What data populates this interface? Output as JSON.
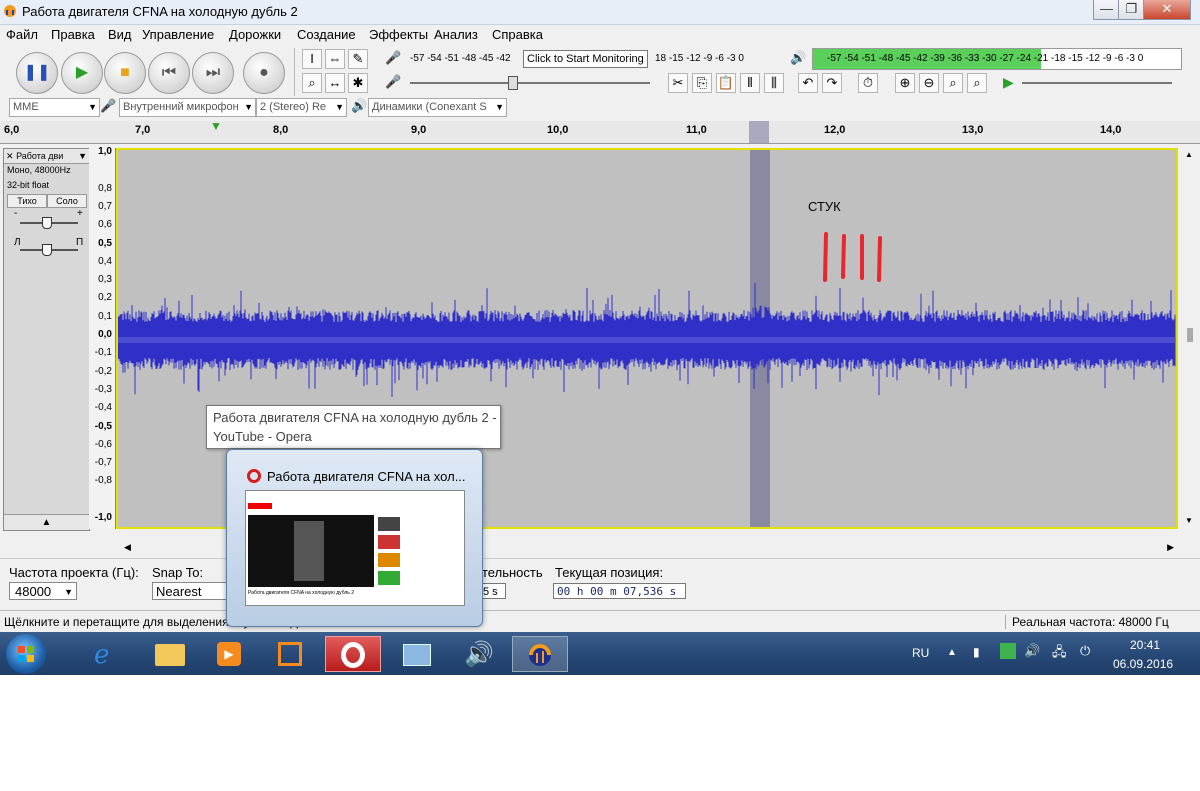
{
  "window": {
    "title": "Работа двигателя CFNA на холодную дубль 2",
    "buttons": {
      "minimize": "—",
      "maximize": "❐",
      "close": "✕"
    }
  },
  "menu": [
    "Файл",
    "Правка",
    "Вид",
    "Управление",
    "Дорожки",
    "Создание",
    "Эффекты",
    "Анализ",
    "Справка"
  ],
  "meters": {
    "record_scale": "-57 -54 -51 -48 -45 -42",
    "record_scale_right": "18 -15 -12 -9 -6 -3 0",
    "monitor_tooltip": "Click to Start Monitoring",
    "playback_scale": "-57 -54 -51 -48 -45 -42 -39 -36 -33 -30 -27 -24 -21 -18 -15 -12 -9 -6 -3 0",
    "playback_level": 0.62
  },
  "devices": {
    "host": "MME",
    "mic": "Внутренний микрофон",
    "channels": "2 (Stereo) Re",
    "speakers": "Динамики (Conexant S"
  },
  "ruler": {
    "labels": [
      "6,0",
      "7,0",
      "8,0",
      "9,0",
      "10,0",
      "11,0",
      "12,0",
      "13,0",
      "14,0"
    ],
    "cursor_label": "▼"
  },
  "track": {
    "name": "Работа дви",
    "info1": "Моно, 48000Hz",
    "info2": "32-bit float",
    "mute": "Тихо",
    "solo": "Соло",
    "gain_minus": "-",
    "gain_plus": "+",
    "pan_left": "Л",
    "pan_right": "П",
    "collapse": "▲"
  },
  "vscale": [
    "1,0",
    "0,8",
    "0,7",
    "0,6",
    "0,5",
    "0,4",
    "0,3",
    "0,2",
    "0,1",
    "0,0",
    "-0,1",
    "-0,2",
    "-0,3",
    "-0,4",
    "-0,5",
    "-0,6",
    "-0,7",
    "-0,8",
    "-1,0"
  ],
  "annotation": {
    "text": "СТУК",
    "color": "#e8262d"
  },
  "colors": {
    "waveform": "#3030c8",
    "background": "#c0c0c0",
    "selection": "#7a7a9a"
  },
  "selection_bar": {
    "rate_label": "Частота проекта (Гц):",
    "rate_value": "48000",
    "snap_label": "Snap To:",
    "snap_value": "Nearest",
    "length_label": "тельность",
    "length_value": "5 s",
    "position_label": "Текущая позиция:",
    "position_value": "00 h 00 m 07,536 s"
  },
  "status": {
    "left": "Щёлкните и перетащите для выделения звуковых фрагментов",
    "right": "Реальная частота: 48000 Гц"
  },
  "taskbar": {
    "lang": "RU",
    "time": "20:41",
    "date": "06.09.2016"
  },
  "preview": {
    "tooltip_line1": "Работа двигателя CFNA на холодную дубль 2 -",
    "tooltip_line2": "YouTube - Opera",
    "title": "Работа двигателя CFNA на хол...",
    "caption": "Работа двигателя CFNA на холодную дубль 2"
  }
}
